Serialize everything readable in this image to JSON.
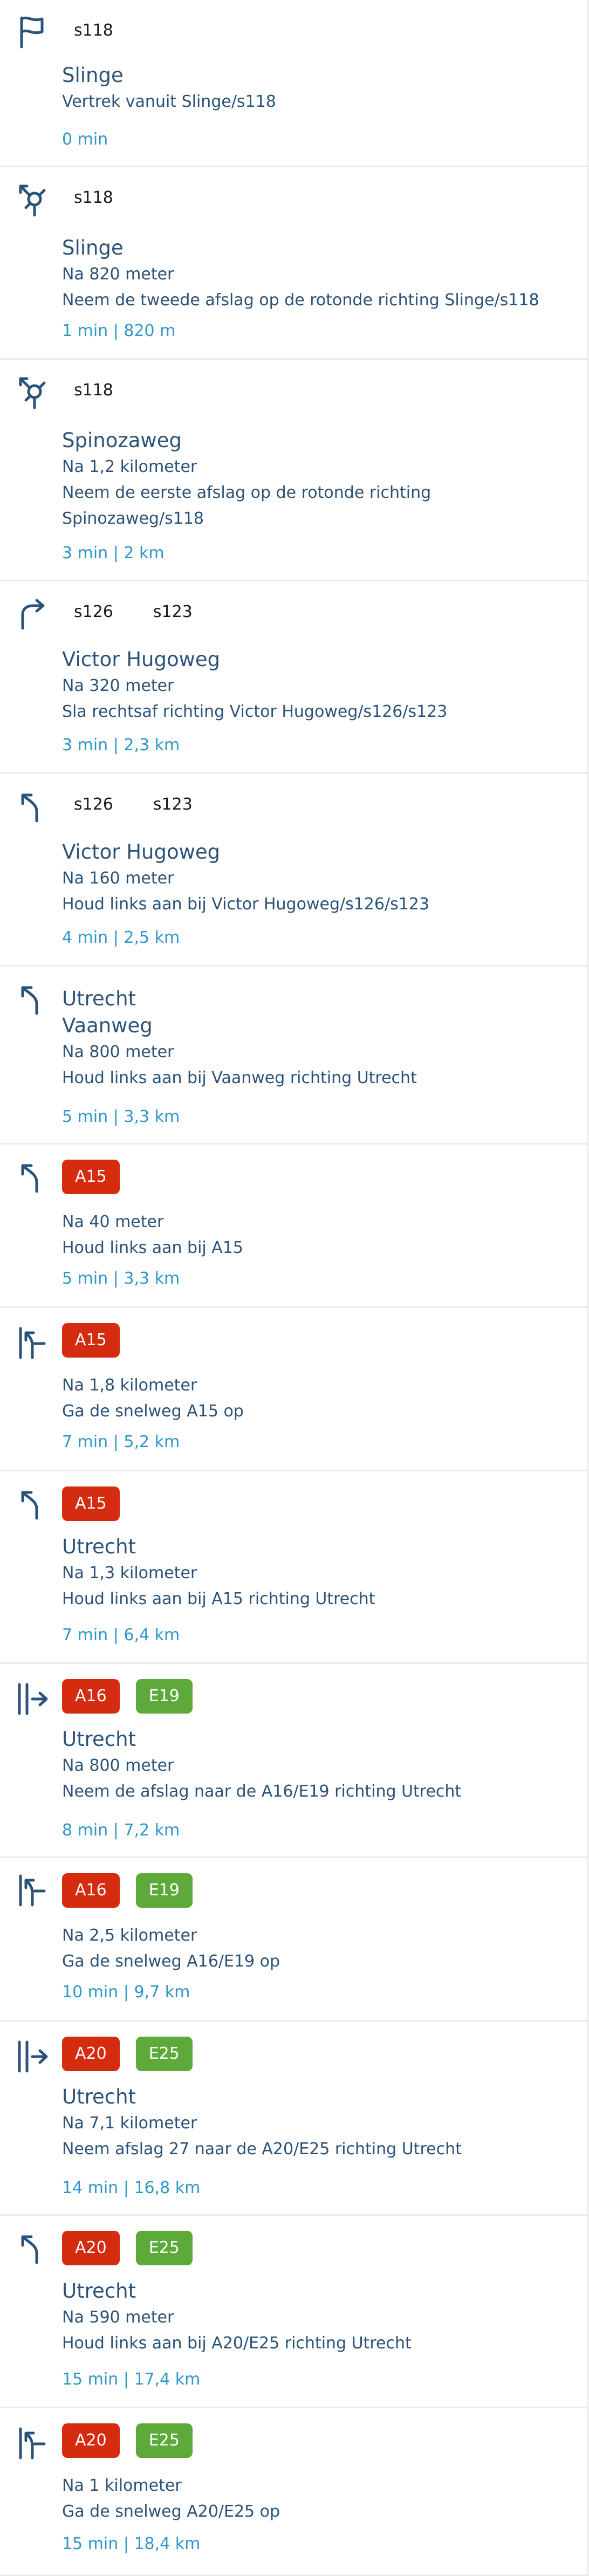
{
  "colors": {
    "primary_text": "#2b5278",
    "meta_text": "#2f97c9",
    "a_road_badge": "#d52b0f",
    "e_road_badge": "#5daa3a"
  },
  "steps": [
    {
      "icon": "flag-icon",
      "roads": [
        {
          "label": "s118",
          "style": "plain"
        }
      ],
      "texts": [
        "Slinge",
        "Vertrek vanuit Slinge/s118"
      ],
      "meta": "0 min"
    },
    {
      "icon": "roundabout-icon",
      "roads": [
        {
          "label": "s118",
          "style": "plain"
        }
      ],
      "texts": [
        "Slinge",
        "Na 820 meter",
        "Neem de tweede afslag op de rotonde richting Slinge/s118"
      ],
      "meta": "1 min | 820 m"
    },
    {
      "icon": "roundabout-icon",
      "roads": [
        {
          "label": "s118",
          "style": "plain"
        }
      ],
      "texts": [
        "Spinozaweg",
        "Na 1,2 kilometer",
        "Neem de eerste afslag op de rotonde richting",
        "Spinozaweg/s118"
      ],
      "meta": "3 min | 2 km"
    },
    {
      "icon": "turn-right-icon",
      "roads": [
        {
          "label": "s126",
          "style": "plain"
        },
        {
          "label": "s123",
          "style": "plain"
        }
      ],
      "texts": [
        "Victor Hugoweg",
        "Na 320 meter",
        "Sla rechtsaf richting Victor Hugoweg/s126/s123"
      ],
      "meta": "3 min | 2,3 km"
    },
    {
      "icon": "keep-left-icon",
      "roads": [
        {
          "label": "s126",
          "style": "plain"
        },
        {
          "label": "s123",
          "style": "plain"
        }
      ],
      "texts": [
        "Victor Hugoweg",
        "Na 160 meter",
        "Houd links aan bij Victor Hugoweg/s126/s123"
      ],
      "meta": "4 min | 2,5 km"
    },
    {
      "icon": "keep-left-icon",
      "roads": [],
      "texts": [
        "Utrecht",
        "Vaanweg",
        "Na 800 meter",
        "Houd links aan bij Vaanweg richting Utrecht"
      ],
      "meta": "5 min | 3,3 km"
    },
    {
      "icon": "keep-left-icon",
      "roads": [
        {
          "label": "A15",
          "style": "a"
        }
      ],
      "texts": [
        "Na 40 meter",
        "Houd links aan bij A15"
      ],
      "meta": "5 min | 3,3 km"
    },
    {
      "icon": "merge-motorway-icon",
      "roads": [
        {
          "label": "A15",
          "style": "a"
        }
      ],
      "texts": [
        "Na 1,8 kilometer",
        "Ga de snelweg A15 op"
      ],
      "meta": "7 min | 5,2 km"
    },
    {
      "icon": "keep-left-icon",
      "roads": [
        {
          "label": "A15",
          "style": "a"
        }
      ],
      "texts": [
        "Utrecht",
        "Na 1,3 kilometer",
        "Houd links aan bij A15 richting Utrecht"
      ],
      "meta": "7 min | 6,4 km"
    },
    {
      "icon": "exit-icon",
      "roads": [
        {
          "label": "A16",
          "style": "a"
        },
        {
          "label": "E19",
          "style": "e"
        }
      ],
      "texts": [
        "Utrecht",
        "Na 800 meter",
        "Neem de afslag naar de A16/E19 richting Utrecht"
      ],
      "meta": "8 min | 7,2 km"
    },
    {
      "icon": "merge-motorway-icon",
      "roads": [
        {
          "label": "A16",
          "style": "a"
        },
        {
          "label": "E19",
          "style": "e"
        }
      ],
      "texts": [
        "Na 2,5 kilometer",
        "Ga de snelweg A16/E19 op"
      ],
      "meta": "10 min | 9,7 km"
    },
    {
      "icon": "exit-icon",
      "roads": [
        {
          "label": "A20",
          "style": "a"
        },
        {
          "label": "E25",
          "style": "e"
        }
      ],
      "texts": [
        "Utrecht",
        "Na 7,1 kilometer",
        "Neem afslag 27 naar de A20/E25 richting Utrecht"
      ],
      "meta": "14 min | 16,8 km"
    },
    {
      "icon": "keep-left-icon",
      "roads": [
        {
          "label": "A20",
          "style": "a"
        },
        {
          "label": "E25",
          "style": "e"
        }
      ],
      "texts": [
        "Utrecht",
        "Na 590 meter",
        "Houd links aan bij A20/E25 richting Utrecht"
      ],
      "meta": "15 min | 17,4 km"
    },
    {
      "icon": "merge-motorway-icon",
      "roads": [
        {
          "label": "A20",
          "style": "a"
        },
        {
          "label": "E25",
          "style": "e"
        }
      ],
      "texts": [
        "Na 1 kilometer",
        "Ga de snelweg A20/E25 op"
      ],
      "meta": "15 min | 18,4 km"
    }
  ]
}
